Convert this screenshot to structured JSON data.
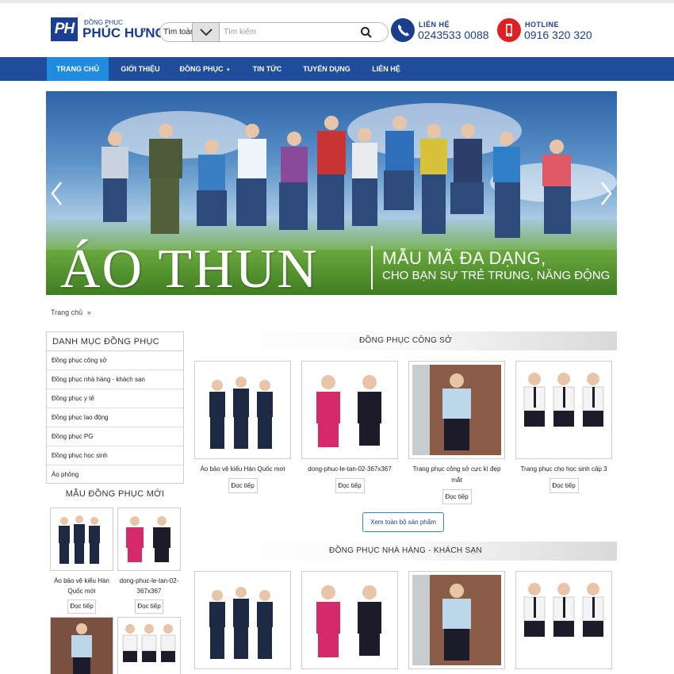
{
  "header": {
    "logo_mark": "PH",
    "logo_small": "ĐỒNG PHỤC",
    "logo_name": "PHÚC HƯNG",
    "search_scope": "Tìm toàn bộ",
    "search_placeholder": "Tìm kiếm",
    "contact": {
      "title": "LIÊN HỆ",
      "phone": "0243533 0088"
    },
    "hotline": {
      "title": "HOTLINE",
      "phone": "0916 320 320"
    }
  },
  "nav": {
    "items": [
      "TRANG CHỦ",
      "GIỚI THIỆU",
      "ĐỒNG PHỤC",
      "TIN TỨC",
      "TUYỂN DỤNG",
      "LIÊN HỆ"
    ],
    "active": "TRANG CHỦ",
    "dropdown_marker": "▾"
  },
  "banner": {
    "headline": "ÁO THUN",
    "line1": "MẪU MÃ ĐA DẠNG,",
    "line2": "CHO BẠN SỰ TRẺ TRUNG, NĂNG ĐỘNG"
  },
  "breadcrumb": {
    "home": "Trang chủ",
    "sep": "»"
  },
  "sidebar": {
    "category_title": "DANH MỤC ĐỒNG PHỤC",
    "categories": [
      "Đồng phục công sở",
      "Đồng phục nhà hàng - khách sạn",
      "Đồng phục y tế",
      "Đồng phục lao động",
      "Đồng phục PG",
      "Đồng phục học sinh",
      "Áo phông"
    ],
    "new_title": "MẪU ĐỒNG PHỤC MỚI",
    "new_products": [
      {
        "name": "Áo bảo vệ kiểu Hàn Quốc mới",
        "button": "Đọc tiếp"
      },
      {
        "name": "dong-phuc-le-tan-02-367x367",
        "button": "Đọc tiếp"
      }
    ]
  },
  "sections": [
    {
      "title": "ĐỒNG PHỤC CÔNG SỞ",
      "products": [
        {
          "name": "Áo bảo vệ kiểu Hàn Quốc mơi",
          "button": "Đọc tiếp"
        },
        {
          "name": "dong-phuc-le-tan-02-367x367",
          "button": "Đọc tiếp"
        },
        {
          "name": "Trang phục công sở cực kì đẹp mắt",
          "button": "Đọc tiếp"
        },
        {
          "name": "Trang phục cho học sinh cấp 3",
          "button": "Đọc tiếp"
        }
      ],
      "view_all": "Xem toàn bộ sản phẩm"
    },
    {
      "title": "ĐỒNG PHỤC NHÀ HÀNG - KHÁCH SẠN"
    }
  ],
  "colors": {
    "brand": "#1b3f8f",
    "nav_bg": "#1f4d9c",
    "nav_active": "#1f8ce0",
    "hotline": "#e02020"
  }
}
